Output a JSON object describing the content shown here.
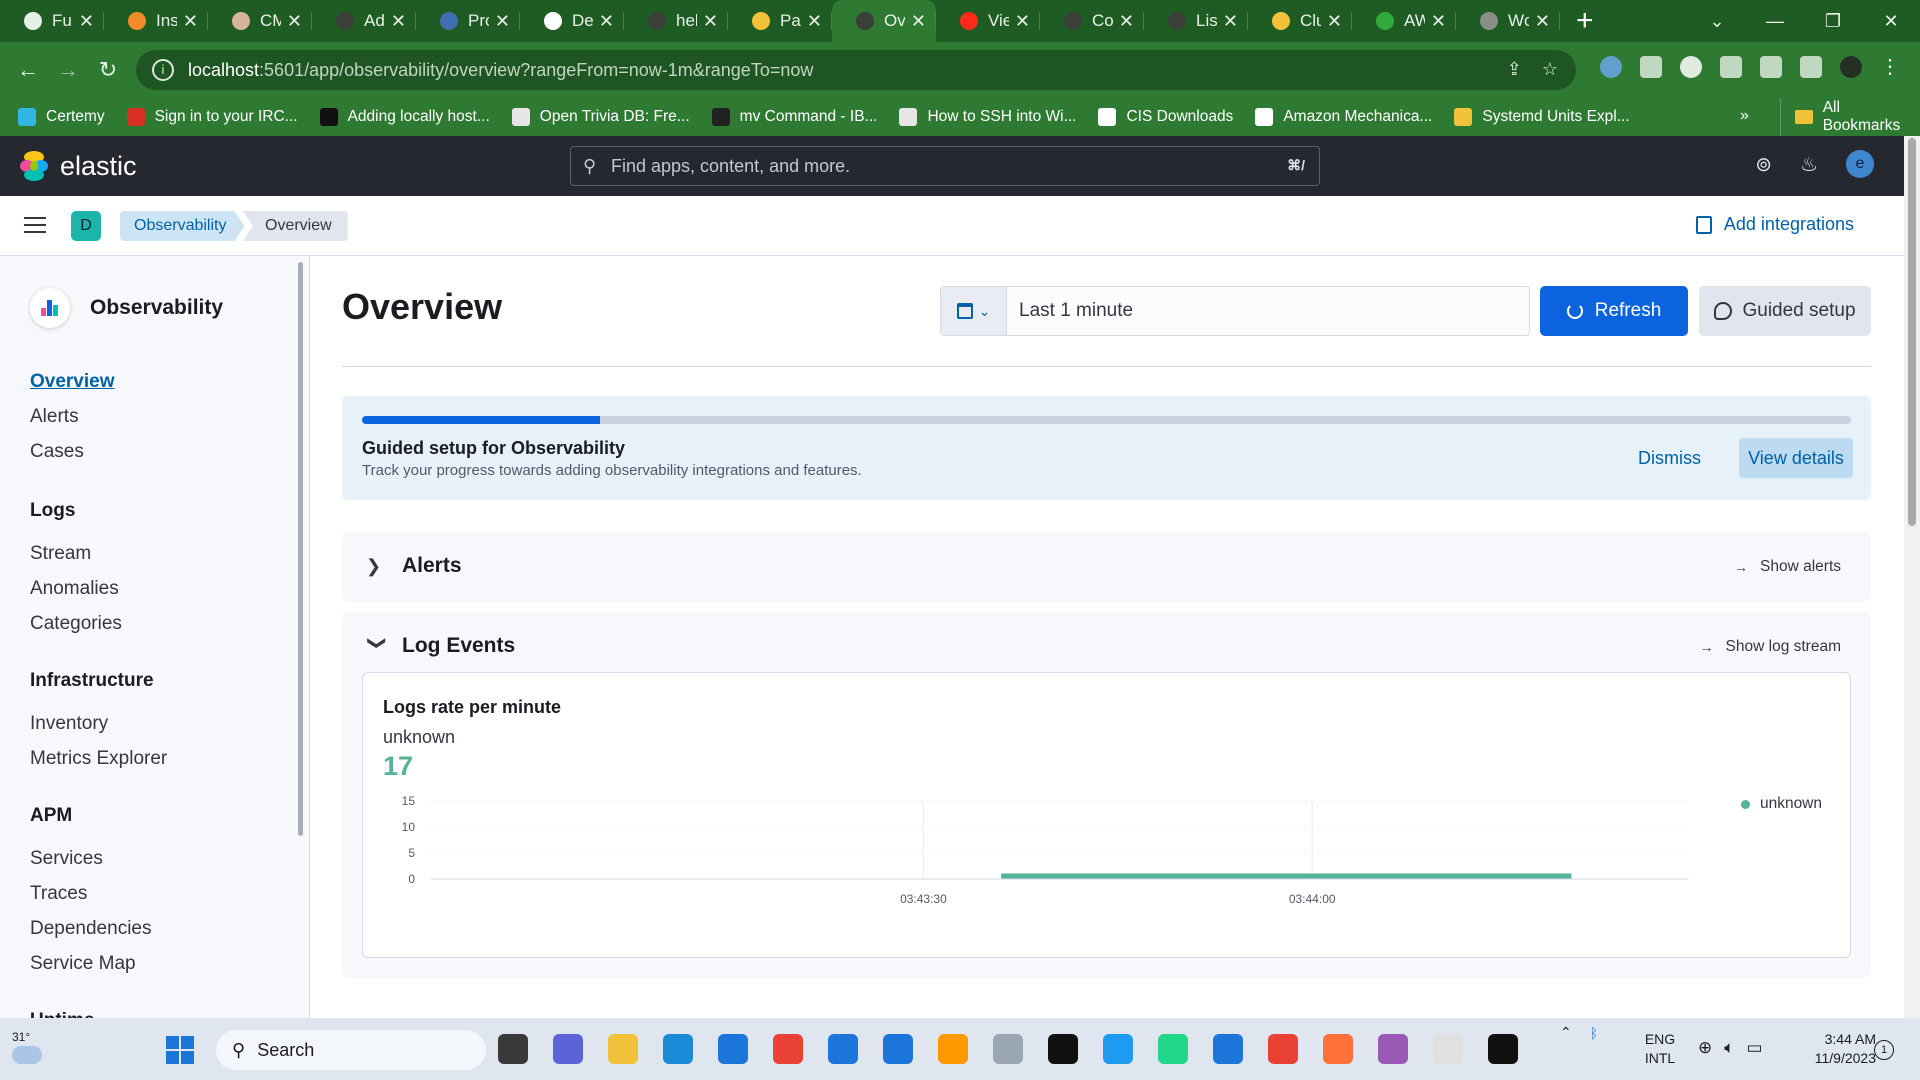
{
  "browser": {
    "tabs": [
      {
        "title": "Ful",
        "color": "#e6efe6"
      },
      {
        "title": "Ins",
        "color": "#f08a2a"
      },
      {
        "title": "CM",
        "color": "#d8b49a"
      },
      {
        "title": "Ad",
        "color": "#3a3f3a"
      },
      {
        "title": "Pro",
        "color": "#3f6fb0"
      },
      {
        "title": "De",
        "color": "#ffffff"
      },
      {
        "title": "hel",
        "color": "#3a3f3a"
      },
      {
        "title": "Par",
        "color": "#f2c23a"
      },
      {
        "title": "Ov",
        "color": "#3a3f3a"
      },
      {
        "title": "Vie",
        "color": "#ff2a1a"
      },
      {
        "title": "Co",
        "color": "#3a3f3a"
      },
      {
        "title": "Lis",
        "color": "#3a3f3a"
      },
      {
        "title": "Clu",
        "color": "#f2c23a"
      },
      {
        "title": "AW",
        "color": "#2faa3a"
      },
      {
        "title": "Wc",
        "color": "#8a8f8a"
      }
    ],
    "active_tab_index": 8,
    "url_host": "localhost",
    "url_path": ":5601/app/observability/overview?rangeFrom=now-1m&rangeTo=now",
    "bookmarks": [
      {
        "label": "Certemy",
        "color": "#33b5e5"
      },
      {
        "label": "Sign in to your IRC...",
        "color": "#d93025"
      },
      {
        "label": "Adding locally host...",
        "color": "#111111"
      },
      {
        "label": "Open Trivia DB: Fre...",
        "color": "#e6e6e6"
      },
      {
        "label": "mv Command - IB...",
        "color": "#222222"
      },
      {
        "label": "How to SSH into Wi...",
        "color": "#e6e6e6"
      },
      {
        "label": "CIS Downloads",
        "color": "#ffffff"
      },
      {
        "label": "Amazon Mechanica...",
        "color": "#ffffff"
      },
      {
        "label": "Systemd Units Expl...",
        "color": "#f2c23a"
      }
    ],
    "more_bookmarks": "»",
    "all_bookmarks": "All Bookmarks"
  },
  "header": {
    "brand": "elastic",
    "search_placeholder": "Find apps, content, and more.",
    "search_shortcut": "⌘/",
    "avatar_letter": "e"
  },
  "breadcrumbs": {
    "space_letter": "D",
    "items": [
      "Observability",
      "Overview"
    ],
    "add_integrations": "Add integrations"
  },
  "sidenav": {
    "title": "Observability",
    "top_items": [
      {
        "label": "Overview",
        "active": true
      },
      {
        "label": "Alerts",
        "active": false
      },
      {
        "label": "Cases",
        "active": false
      }
    ],
    "groups": [
      {
        "heading": "Logs",
        "items": [
          "Stream",
          "Anomalies",
          "Categories"
        ]
      },
      {
        "heading": "Infrastructure",
        "items": [
          "Inventory",
          "Metrics Explorer"
        ]
      },
      {
        "heading": "APM",
        "items": [
          "Services",
          "Traces",
          "Dependencies",
          "Service Map"
        ]
      },
      {
        "heading": "Uptime",
        "items": []
      }
    ]
  },
  "main": {
    "title": "Overview",
    "date_range": "Last 1 minute",
    "refresh_label": "Refresh",
    "guided_setup_label": "Guided setup",
    "guide": {
      "title": "Guided setup for Observability",
      "subtitle": "Track your progress towards adding observability integrations and features.",
      "progress": 0.16,
      "dismiss": "Dismiss",
      "view_details": "View details"
    },
    "alerts_section": {
      "title": "Alerts",
      "link": "Show alerts",
      "expanded": false
    },
    "logs_section": {
      "title": "Log Events",
      "link": "Show log stream",
      "expanded": true
    },
    "logs_card": {
      "title": "Logs rate per minute",
      "metric_label": "unknown",
      "metric_value": "17"
    }
  },
  "chart_data": {
    "type": "line",
    "title": "Logs rate per minute",
    "series": [
      {
        "name": "unknown",
        "color": "#54b399",
        "x": [
          "03:43:36",
          "03:44:20"
        ],
        "values": [
          0,
          0
        ]
      }
    ],
    "x_ticks": [
      "03:43:30",
      "03:44:00"
    ],
    "y_ticks": [
      0,
      5,
      10,
      15
    ],
    "ylim": [
      0,
      15
    ],
    "grid": true,
    "legend_position": "right"
  },
  "taskbar": {
    "temperature": "31°",
    "search_label": "Search",
    "lang_top": "ENG",
    "lang_bottom": "INTL",
    "time": "3:44 AM",
    "date": "11/9/2023",
    "notification_count": "1"
  }
}
